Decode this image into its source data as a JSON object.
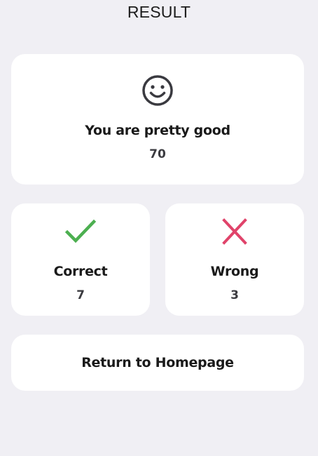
{
  "page": {
    "title": "RESULT"
  },
  "summary": {
    "icon": "smiley-face-icon",
    "message": "You are pretty good",
    "score": "70"
  },
  "correct": {
    "icon": "checkmark-icon",
    "label": "Correct",
    "count": "7",
    "color": "#4caf50"
  },
  "wrong": {
    "icon": "cross-icon",
    "label": "Wrong",
    "count": "3",
    "color": "#e0436a"
  },
  "actions": {
    "return_label": "Return to Homepage"
  },
  "colors": {
    "background": "#f0eff4",
    "card": "#ffffff",
    "text": "#1a1a1a"
  }
}
